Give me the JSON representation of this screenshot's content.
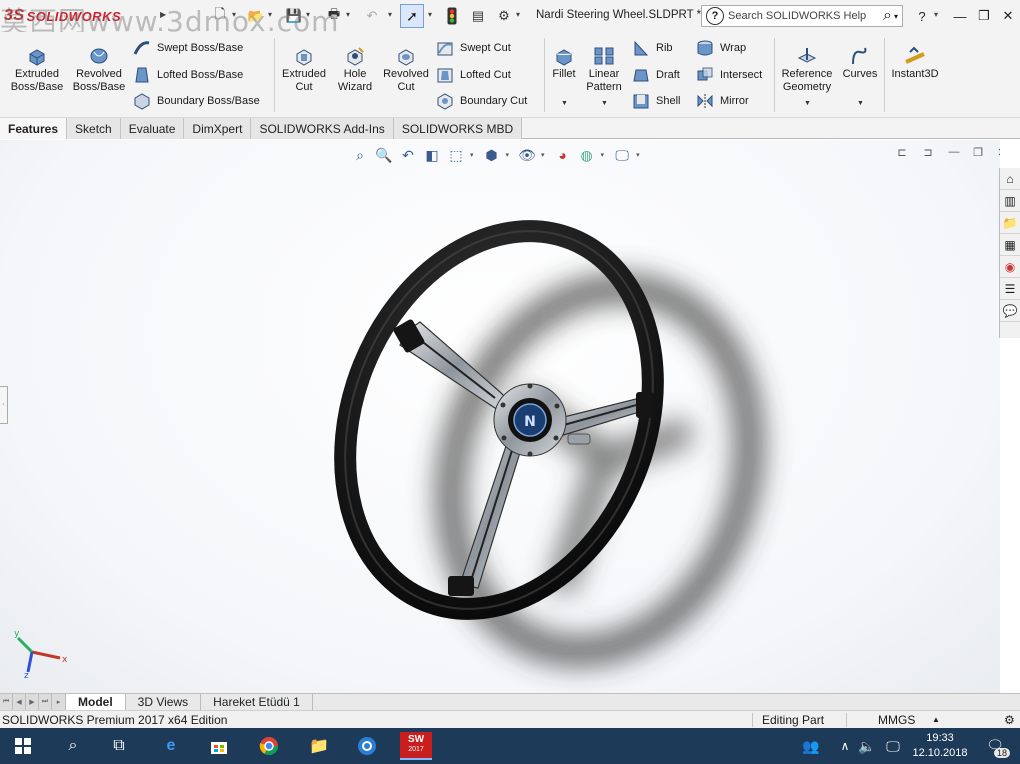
{
  "watermark": "莫西网www.3dmox.com",
  "app": {
    "logo_text": "SOLIDWORKS",
    "document_title": "Nardi Steering Wheel.SLDPRT *"
  },
  "search": {
    "placeholder": "Search SOLIDWORKS Help",
    "help_icon": "?"
  },
  "window": {
    "help": "?",
    "minimize": "—",
    "restore": "❐",
    "close": "✕"
  },
  "features_toolbar": {
    "extruded_boss": "Extruded Boss/Base",
    "revolved_boss": "Revolved Boss/Base",
    "swept_boss": "Swept Boss/Base",
    "lofted_boss": "Lofted Boss/Base",
    "boundary_boss": "Boundary Boss/Base",
    "extruded_cut": "Extruded Cut",
    "hole_wizard": "Hole Wizard",
    "revolved_cut": "Revolved Cut",
    "swept_cut": "Swept Cut",
    "lofted_cut": "Lofted Cut",
    "boundary_cut": "Boundary Cut",
    "fillet": "Fillet",
    "linear_pattern": "Linear Pattern",
    "rib": "Rib",
    "draft": "Draft",
    "shell": "Shell",
    "wrap": "Wrap",
    "intersect": "Intersect",
    "mirror": "Mirror",
    "reference_geometry": "Reference Geometry",
    "curves": "Curves",
    "instant3d": "Instant3D"
  },
  "tabs": [
    "Features",
    "Sketch",
    "Evaluate",
    "DimXpert",
    "SOLIDWORKS Add-Ins",
    "SOLIDWORKS MBD"
  ],
  "bottom_tabs": [
    "Model",
    "3D Views",
    "Hareket Etüdü 1"
  ],
  "status": {
    "edition": "SOLIDWORKS Premium 2017 x64 Edition",
    "mode": "Editing Part",
    "units": "MMGS"
  },
  "taskbar": {
    "time": "19:33",
    "date": "12.10.2018",
    "notifications": "18",
    "sw_label": "SW",
    "sw_year": "2017"
  },
  "colors": {
    "accent": "#c81e1e",
    "taskbar": "#1d3a58",
    "wheel_rim": "#111111",
    "spoke": "#9aa1a8"
  }
}
